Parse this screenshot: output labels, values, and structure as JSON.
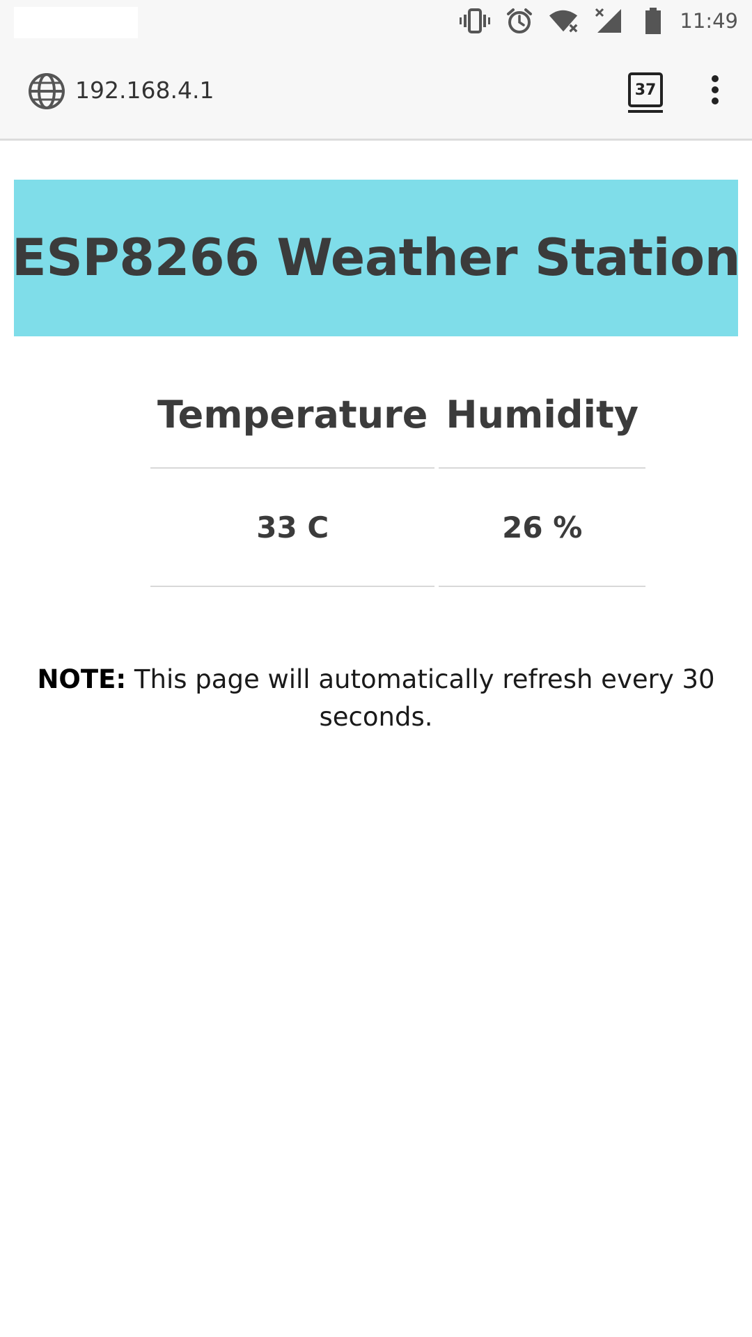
{
  "status_bar": {
    "time": "11:49",
    "icons": [
      "vibrate-icon",
      "alarm-icon",
      "wifi-no-internet-icon",
      "cell-signal-off-icon",
      "battery-icon"
    ]
  },
  "browser": {
    "url": "192.168.4.1",
    "tab_count": "37"
  },
  "page": {
    "title": "ESP8266 Weather Station",
    "banner_color": "#7fdde9",
    "table": {
      "headers": [
        "Temperature",
        "Humidity"
      ],
      "values": [
        "33 C",
        "26 %"
      ]
    },
    "note_label": "NOTE:",
    "note_text": " This page will automatically refresh every 30 seconds."
  }
}
